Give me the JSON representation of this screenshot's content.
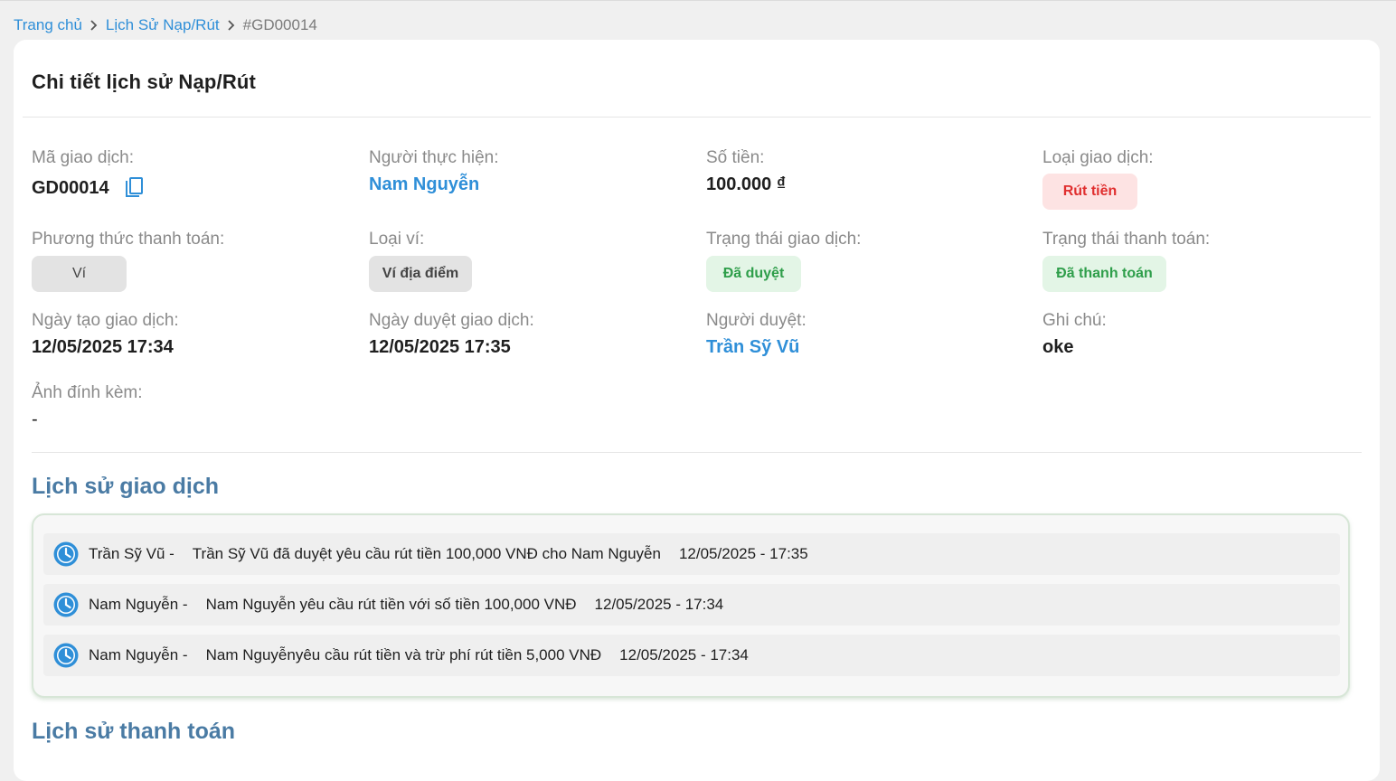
{
  "breadcrumb": {
    "home": "Trang chủ",
    "history": "Lịch Sử Nạp/Rút",
    "current": "#GD00014"
  },
  "card": {
    "title": "Chi tiết lịch sử Nạp/Rút"
  },
  "fields": {
    "transaction_code": {
      "label": "Mã giao dịch:",
      "value": "GD00014"
    },
    "performer": {
      "label": "Người thực hiện:",
      "value": "Nam Nguyễn"
    },
    "amount": {
      "label": "Số tiền:",
      "value": "100.000 ₫"
    },
    "transaction_type": {
      "label": "Loại giao dịch:",
      "value": "Rút tiền"
    },
    "payment_method": {
      "label": "Phương thức thanh toán:",
      "value": "Ví"
    },
    "wallet_type": {
      "label": "Loại ví:",
      "value": "Ví địa điểm"
    },
    "transaction_status": {
      "label": "Trạng thái giao dịch:",
      "value": "Đã duyệt"
    },
    "payment_status": {
      "label": "Trạng thái thanh toán:",
      "value": "Đã thanh toán"
    },
    "created_at": {
      "label": "Ngày tạo giao dịch:",
      "value": "12/05/2025 17:34"
    },
    "approved_at": {
      "label": "Ngày duyệt giao dịch:",
      "value": "12/05/2025 17:35"
    },
    "approver": {
      "label": "Người duyệt:",
      "value": "Trần Sỹ Vũ"
    },
    "note": {
      "label": "Ghi chú:",
      "value": "oke"
    },
    "attachment": {
      "label": "Ảnh đính kèm:",
      "value": "-"
    }
  },
  "transaction_history": {
    "title": "Lịch sử giao dịch",
    "items": [
      {
        "actor": "Trần Sỹ Vũ -",
        "message": "Trần Sỹ Vũ đã duyệt yêu cầu rút tiền 100,000 VNĐ cho Nam Nguyễn",
        "time": "12/05/2025 - 17:35"
      },
      {
        "actor": "Nam Nguyễn -",
        "message": "Nam Nguyễn yêu cầu rút tiền với số tiền 100,000 VNĐ",
        "time": "12/05/2025 - 17:34"
      },
      {
        "actor": "Nam Nguyễn -",
        "message": "Nam Nguyễnyêu cầu rút tiền và trừ phí rút tiền 5,000 VNĐ",
        "time": "12/05/2025 - 17:34"
      }
    ]
  },
  "payment_history": {
    "title": "Lịch sử thanh toán"
  },
  "icons": {
    "breadcrumb_separator": "chevron-right-icon",
    "copy": "copy-icon",
    "history_item": "clock-icon"
  },
  "colors": {
    "link": "#2f8fd8",
    "section_title": "#4a7ba4",
    "withdraw_badge_text": "#e02f2f",
    "withdraw_badge_bg": "#fde3e3",
    "success_text": "#2e9e4a",
    "success_bg": "#e3f5e6",
    "clock_icon": "#2f8fd8"
  }
}
